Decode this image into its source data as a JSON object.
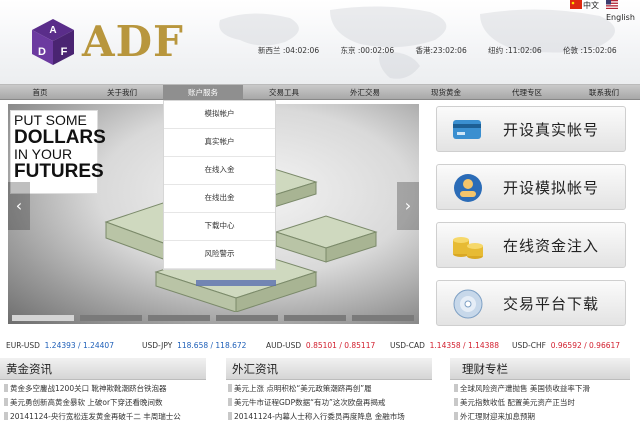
{
  "header": {
    "brand": "ADF",
    "logo_letters": [
      "A",
      "D",
      "F"
    ],
    "languages": [
      {
        "label": "中文",
        "flag": "flag-china-icon"
      },
      {
        "label": "English",
        "flag": "flag-usa-icon"
      }
    ],
    "clocks": [
      "新西兰 :04:02:06",
      "东京 :00:02:06",
      "香港:23:02:06",
      "纽约 :11:02:06",
      "伦敦 :15:02:06"
    ]
  },
  "nav": {
    "items": [
      "首页",
      "关于我们",
      "账户服务",
      "交易工具",
      "外汇交易",
      "现货黄金",
      "代理专区",
      "联系我们"
    ],
    "active_index": 2
  },
  "dropdown": {
    "items": [
      "模拟帐户",
      "真实帐户",
      "在线入金",
      "在线出金",
      "下载中心",
      "风险警示"
    ]
  },
  "banner": {
    "ad_lines": [
      "PUT SOME",
      "DOLLARS",
      "IN YOUR",
      "FUTURES"
    ],
    "prev": "‹",
    "next": "›"
  },
  "side_buttons": [
    {
      "label": "开设真实帐号",
      "icon": "credit-card-icon"
    },
    {
      "label": "开设模拟帐号",
      "icon": "test-user-icon"
    },
    {
      "label": "在线资金注入",
      "icon": "coins-icon"
    },
    {
      "label": "交易平台下载",
      "icon": "disc-icon"
    }
  ],
  "ticker": [
    {
      "pair": "EUR-USD",
      "value": "1.24393 / 1.24407",
      "color": "#1e5fb8"
    },
    {
      "pair": "USD-JPY",
      "value": "118.658 / 118.672",
      "color": "#1e5fb8"
    },
    {
      "pair": "AUD-USD",
      "value": "0.85101 / 0.85117",
      "color": "#d2202f"
    },
    {
      "pair": "USD-CAD",
      "value": "1.14358 / 1.14388",
      "color": "#d2202f"
    },
    {
      "pair": "USD-CHF",
      "value": "0.96592 / 0.96617",
      "color": "#d2202f"
    }
  ],
  "news": {
    "gold": {
      "title": "黄金资讯",
      "items": [
        "黄金多空鏖战1200关口 靴神欺靴潮跻台铁泡器",
        "美元勇创新高黄金暴软 上破or下穿还看晚间数",
        "20141124-央行宽松连发黄金再破千二 丰周瑞士公"
      ]
    },
    "forex": {
      "title": "外汇资讯",
      "items": [
        "美元上涨 点明积松“美元政策潮跻再创”履",
        "美元牛市证程GDP数据“有功”这次欧盘再揭戒",
        "20141124-内幕人士称入行委员再度降息 金融市场"
      ]
    },
    "finance": {
      "title": "理财专栏",
      "items": [
        "全球风险资产遭抛售 美国债收益率下滑",
        "美元指数收低 配置美元资产正当时",
        "外汇理财迎来加息预期"
      ]
    }
  }
}
